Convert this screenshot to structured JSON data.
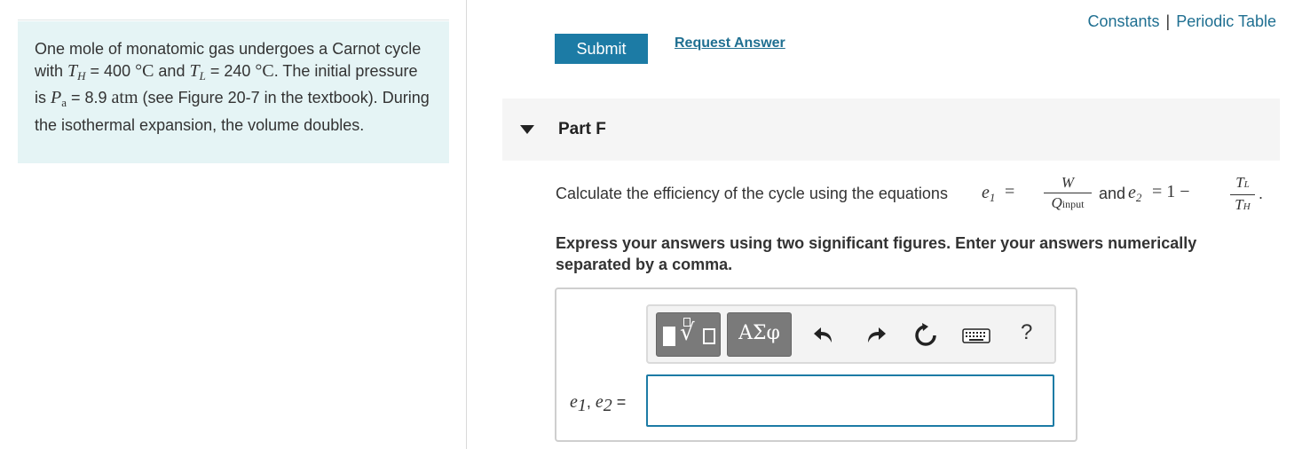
{
  "header_links": {
    "constants": "Constants",
    "separator": "|",
    "periodic_table": "Periodic Table"
  },
  "problem": {
    "text_1": "One mole of monatomic gas undergoes a Carnot cycle with ",
    "th_symbol": "T",
    "th_sub": "H",
    "text_2": " = 400 ",
    "unit_c1": "°C",
    "text_3": " and ",
    "tl_symbol": "T",
    "tl_sub": "L",
    "text_4": " = 240 ",
    "unit_c2": "°C",
    "text_5": ". The initial pressure is ",
    "pa_symbol": "P",
    "pa_sub": "a",
    "text_6": " = 8.9 ",
    "unit_atm": "atm",
    "text_7": " (see Figure 20-7 in the textbook). During the isothermal expansion, the volume doubles."
  },
  "actions": {
    "submit_label": "Submit",
    "request_answer_label": "Request Answer"
  },
  "part": {
    "title": "Part F"
  },
  "question": {
    "text_before": "Calculate the efficiency of the cycle using the equations",
    "e1": "e",
    "e1_sub": "1",
    "eq1": "=",
    "frac1_num": "W",
    "frac1_den": "Q",
    "frac1_den_sub": "input",
    "and": "and",
    "e2": "e",
    "e2_sub": "2",
    "eq2": "= 1 −",
    "frac2_num": "T",
    "frac2_num_sub": "L",
    "frac2_den": "T",
    "frac2_den_sub": "H",
    "period": "."
  },
  "instruction": "Express your answers using two significant figures. Enter your answers numerically separated by a comma.",
  "toolbar": {
    "templates_icon": "templates-icon",
    "symbols_label": "ΑΣφ",
    "undo_icon": "undo-icon",
    "redo_icon": "redo-icon",
    "reset_icon": "reset-icon",
    "keyboard_icon": "keyboard-icon",
    "help_label": "?"
  },
  "answer": {
    "label_e1": "e",
    "label_e1_sub": "1",
    "label_comma": ", ",
    "label_e2": "e",
    "label_e2_sub": "2",
    "label_eq": " =",
    "value": ""
  },
  "colors": {
    "accent": "#1c7ba5",
    "link": "#1f6f91",
    "problem_bg": "#e5f4f5",
    "part_bg": "#f5f5f5"
  }
}
